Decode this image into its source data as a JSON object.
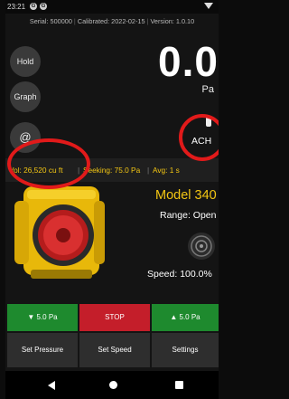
{
  "status_bar": {
    "time": "23:21",
    "icons": [
      "notification-icon",
      "notification-icon"
    ]
  },
  "device_info": {
    "serial": "Serial: 500000",
    "calibrated": "Calibrated: 2022-02-15",
    "version": "Version: 1.0.10"
  },
  "side_buttons": {
    "hold": "Hold",
    "graph": "Graph",
    "at": "@"
  },
  "reading": {
    "value": "0.0",
    "unit": "Pa"
  },
  "mode_label": "ACH",
  "status_line": {
    "volume": "Vol: 26,520 cu ft",
    "seeking": "Seeking: 75.0 Pa",
    "average": "Avg: 1 s"
  },
  "device": {
    "model": "Model 340",
    "range": "Range: Open",
    "speed": "Speed: 100.0%"
  },
  "controls": {
    "decrease": "▼ 5.0 Pa",
    "stop": "STOP",
    "increase": "▲ 5.0 Pa"
  },
  "actions": {
    "set_pressure": "Set Pressure",
    "set_speed": "Set Speed",
    "settings": "Settings"
  },
  "colors": {
    "accent_yellow": "#f3c613",
    "green": "#1e8a2e",
    "red": "#c41e2a",
    "annotation": "#e11a1a"
  }
}
